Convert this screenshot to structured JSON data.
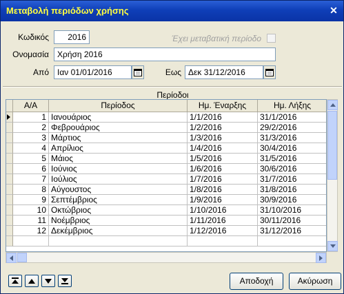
{
  "window": {
    "title": "Μεταβολή περιόδων χρήσης",
    "close_symbol": "✕"
  },
  "form": {
    "code_label": "Κωδικός",
    "code_value": "2016",
    "transitional_label": "Έχει μεταβατική περίοδο",
    "name_label": "Ονομασία",
    "name_value": "Χρήση 2016",
    "from_label": "Από",
    "from_value": "Ιαν 01/01/2016",
    "to_label": "Εως",
    "to_value": "Δεκ 31/12/2016"
  },
  "periods": {
    "title": "Περίοδοι",
    "columns": [
      "Α/Α",
      "Περίοδος",
      "Ημ. Έναρξης",
      "Ημ. Λήξης"
    ],
    "rows": [
      {
        "aa": "1",
        "name": "Ιανουάριος",
        "start": "1/1/2016",
        "end": "31/1/2016"
      },
      {
        "aa": "2",
        "name": "Φεβρουάριος",
        "start": "1/2/2016",
        "end": "29/2/2016"
      },
      {
        "aa": "3",
        "name": "Μάρτιος",
        "start": "1/3/2016",
        "end": "31/3/2016"
      },
      {
        "aa": "4",
        "name": "Απρίλιος",
        "start": "1/4/2016",
        "end": "30/4/2016"
      },
      {
        "aa": "5",
        "name": "Μάιος",
        "start": "1/5/2016",
        "end": "31/5/2016"
      },
      {
        "aa": "6",
        "name": "Ιούνιος",
        "start": "1/6/2016",
        "end": "30/6/2016"
      },
      {
        "aa": "7",
        "name": "Ιούλιος",
        "start": "1/7/2016",
        "end": "31/7/2016"
      },
      {
        "aa": "8",
        "name": "Αύγουστος",
        "start": "1/8/2016",
        "end": "31/8/2016"
      },
      {
        "aa": "9",
        "name": "Σεπτέμβριος",
        "start": "1/9/2016",
        "end": "30/9/2016"
      },
      {
        "aa": "10",
        "name": "Οκτώβριος",
        "start": "1/10/2016",
        "end": "31/10/2016"
      },
      {
        "aa": "11",
        "name": "Νοέμβριος",
        "start": "1/11/2016",
        "end": "30/11/2016"
      },
      {
        "aa": "12",
        "name": "Δεκέμβριος",
        "start": "1/12/2016",
        "end": "31/12/2016"
      },
      {
        "aa": "",
        "name": "",
        "start": "",
        "end": ""
      }
    ]
  },
  "buttons": {
    "ok": "Αποδοχή",
    "cancel": "Ακύρωση"
  }
}
